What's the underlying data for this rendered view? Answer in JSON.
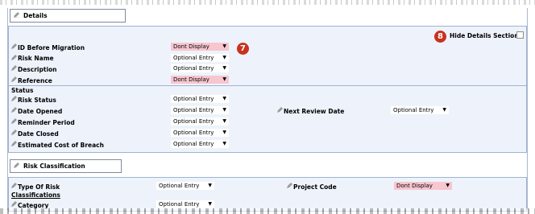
{
  "details": {
    "title": "Details",
    "badge_field": "7",
    "badge_hide": "8",
    "hide_label": "Hide Details Section:",
    "fields": [
      {
        "label": "ID Before Migration",
        "value": "Dont Display"
      },
      {
        "label": "Risk Name",
        "value": "Optional Entry"
      },
      {
        "label": "Description",
        "value": "Optional Entry"
      },
      {
        "label": "Reference",
        "value": "Dont Display"
      }
    ]
  },
  "status": {
    "heading": "Status",
    "fields": [
      {
        "label": "Risk Status",
        "value": "Optional Entry"
      },
      {
        "label": "Date Opened",
        "value": "Optional Entry"
      },
      {
        "label": "Reminder Period",
        "value": "Optional Entry"
      },
      {
        "label": "Date Closed",
        "value": "Optional Entry"
      },
      {
        "label": "Estimated Cost of Breach",
        "value": "Optional Entry"
      }
    ],
    "right_field": {
      "label": "Next Review Date",
      "value": "Optional Entry"
    }
  },
  "classification": {
    "title": "Risk Classification",
    "type_of_risk": {
      "label": "Type Of Risk",
      "value": "Optional Entry"
    },
    "project_code": {
      "label": "Project Code",
      "value": "Dont Display"
    },
    "heading": "Classifications",
    "category": {
      "label": "Category",
      "value": "Optional Entry"
    }
  },
  "colors": {
    "panel_bg": "#eef3fb",
    "dont_display_bg": "#f7c6cf",
    "badge": "#c8321e"
  },
  "icons": {
    "field_icon": "pencil-icon",
    "dropdown_icon": "caret-down-icon",
    "checkbox": "checkbox-empty"
  }
}
